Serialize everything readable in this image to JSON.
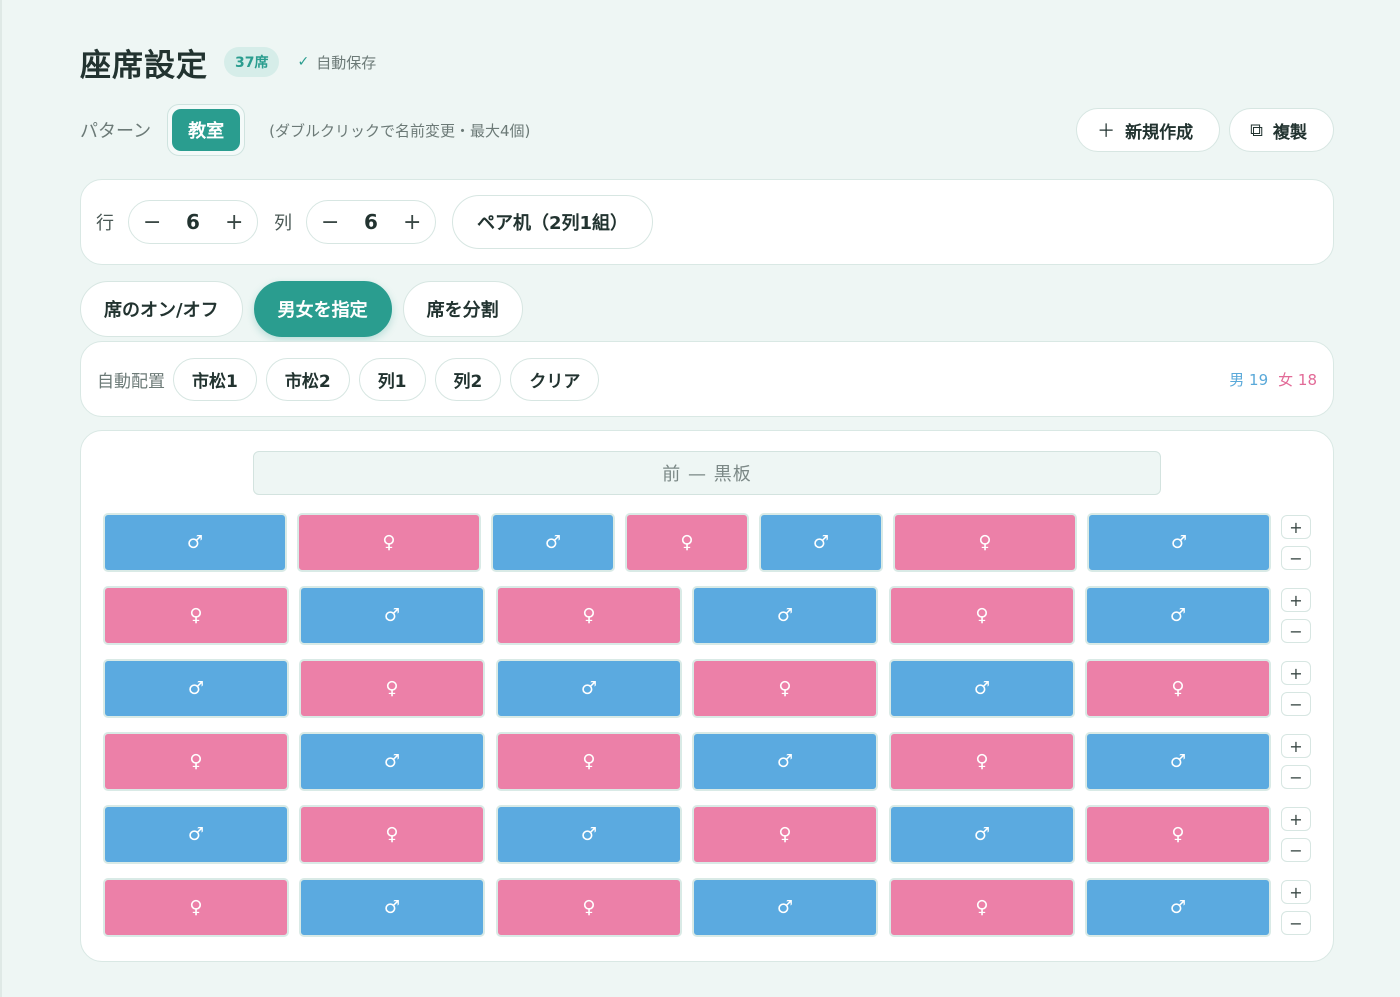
{
  "header": {
    "title": "座席設定",
    "seat_count": "37席",
    "autosave": "自動保存"
  },
  "pattern": {
    "label": "パターン",
    "active_tab": "教室",
    "hint": "(ダブルクリックで名前変更・最大4個)",
    "new_label": "新規作成",
    "copy_label": "複製"
  },
  "size": {
    "rows_label": "行",
    "rows_value": "6",
    "cols_label": "列",
    "cols_value": "6",
    "minus": "−",
    "plus": "+",
    "pair_label": "ペア机（2列1組）"
  },
  "modes": [
    {
      "label": "席のオン/オフ",
      "active": false
    },
    {
      "label": "男女を指定",
      "active": true
    },
    {
      "label": "席を分割",
      "active": false
    }
  ],
  "auto": {
    "label": "自動配置",
    "buttons": [
      "市松1",
      "市松2",
      "列1",
      "列2",
      "クリア"
    ],
    "male_count": "男 19",
    "female_count": "女 18"
  },
  "grid": {
    "front_label": "前 — 黒板",
    "male_symbol": "♂",
    "female_symbol": "♀",
    "row_plus": "+",
    "row_minus": "−",
    "rows": [
      [
        "male",
        "female",
        "male",
        "female",
        "male",
        "female",
        "male"
      ],
      [
        "female",
        "male",
        "female",
        "male",
        "female",
        "male"
      ],
      [
        "male",
        "female",
        "male",
        "female",
        "male",
        "female"
      ],
      [
        "female",
        "male",
        "female",
        "male",
        "female",
        "male"
      ],
      [
        "male",
        "female",
        "male",
        "female",
        "male",
        "female"
      ],
      [
        "female",
        "male",
        "female",
        "male",
        "female",
        "male"
      ]
    ]
  },
  "colors": {
    "accent": "#2a9d8f",
    "male": "#5baae0",
    "female": "#ec80a8",
    "background": "#eef6f4"
  }
}
